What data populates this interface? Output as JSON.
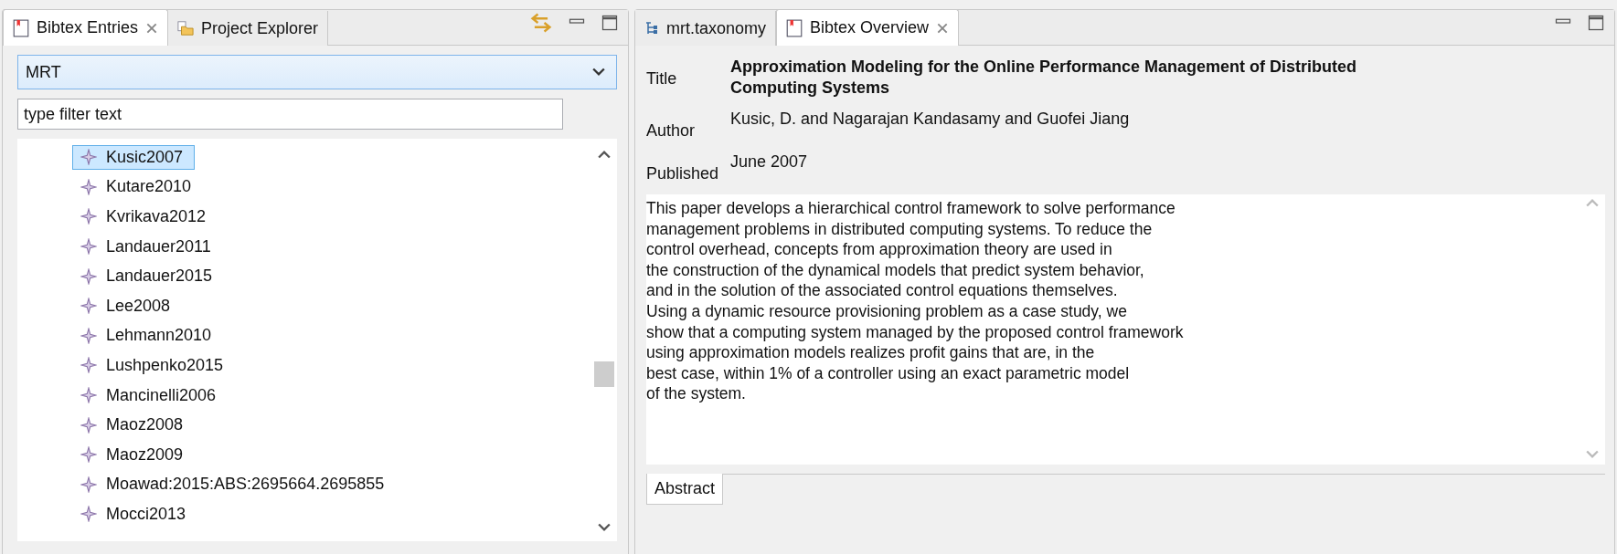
{
  "left_panel": {
    "tabs": [
      {
        "label": "Bibtex Entries",
        "selected": true
      },
      {
        "label": "Project Explorer",
        "selected": false
      }
    ],
    "library_dropdown": {
      "value": "MRT"
    },
    "filter": {
      "placeholder": "type filter text"
    },
    "entries": [
      {
        "label": "Kusic2007",
        "selected": true
      },
      {
        "label": "Kutare2010",
        "selected": false
      },
      {
        "label": "Kvrikava2012",
        "selected": false
      },
      {
        "label": "Landauer2011",
        "selected": false
      },
      {
        "label": "Landauer2015",
        "selected": false
      },
      {
        "label": "Lee2008",
        "selected": false
      },
      {
        "label": "Lehmann2010",
        "selected": false
      },
      {
        "label": "Lushpenko2015",
        "selected": false
      },
      {
        "label": "Mancinelli2006",
        "selected": false
      },
      {
        "label": "Maoz2008",
        "selected": false
      },
      {
        "label": "Maoz2009",
        "selected": false
      },
      {
        "label": "Moawad:2015:ABS:2695664.2695855",
        "selected": false
      },
      {
        "label": "Mocci2013",
        "selected": false
      }
    ]
  },
  "right_panel": {
    "tabs": [
      {
        "label": "mrt.taxonomy",
        "selected": false
      },
      {
        "label": "Bibtex Overview",
        "selected": true
      }
    ],
    "fields": [
      {
        "label": "Title",
        "value": "Approximation Modeling for the Online Performance Management of Distributed Computing Systems"
      },
      {
        "label": "Author",
        "value": "Kusic, D. and Nagarajan Kandasamy and Guofei Jiang"
      },
      {
        "label": "Published",
        "value": "June 2007"
      }
    ],
    "abstract_lines": [
      "This paper develops a hierarchical control framework to solve performance",
      "management problems in distributed computing systems. To reduce the",
      "control overhead, concepts from approximation theory are used in",
      "the construction of the dynamical models that predict system behavior,",
      "and in the solution of the associated control equations themselves.",
      "Using a dynamic resource provisioning problem as a case study, we",
      "show that a computing system managed by the proposed control framework",
      "using approximation models realizes profit gains that are, in the",
      "best case, within 1% of a controller using an exact parametric model",
      "of the system."
    ],
    "bottom_tabs": [
      {
        "label": "Abstract",
        "selected": true
      }
    ]
  }
}
